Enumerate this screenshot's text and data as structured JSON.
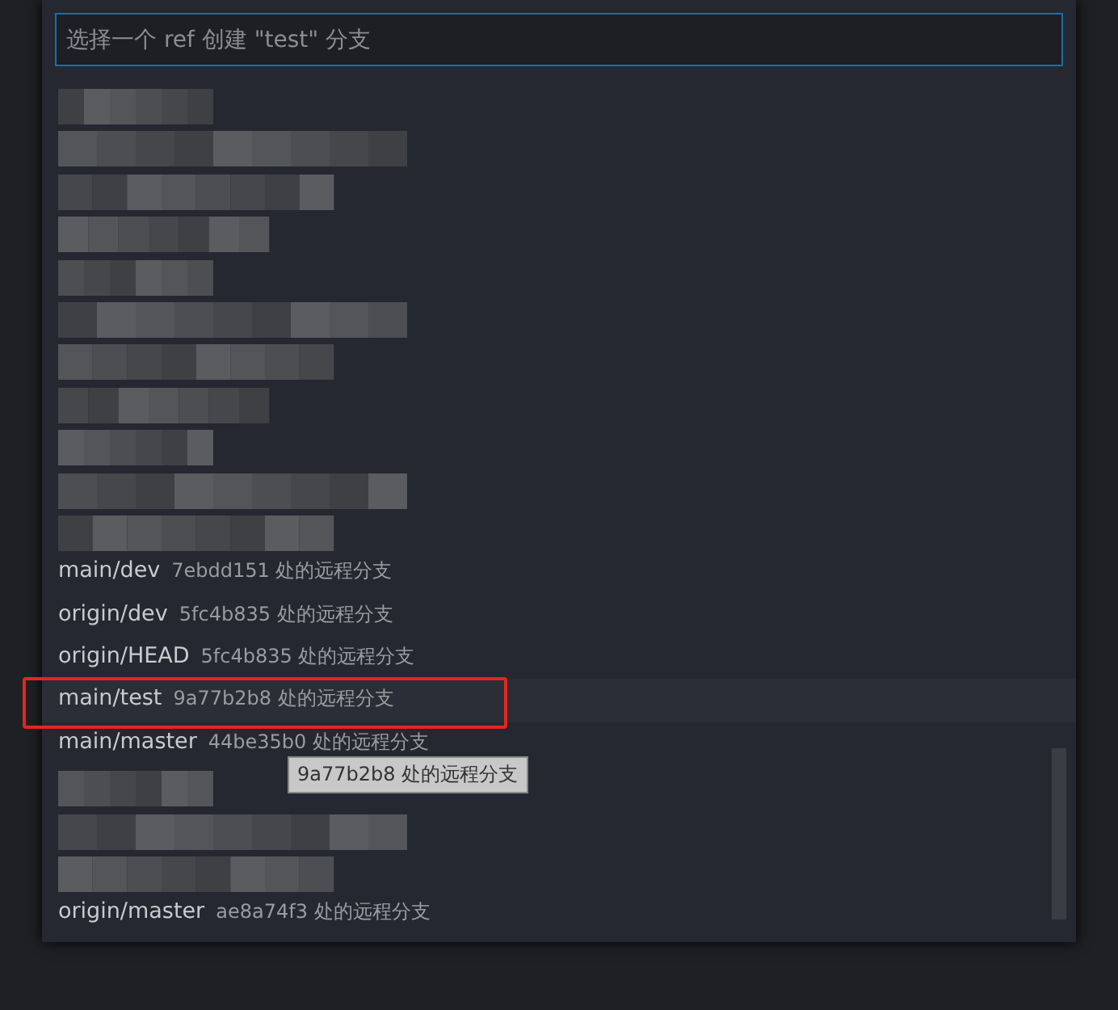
{
  "quick_pick": {
    "placeholder": "选择一个 ref 创建 \"test\" 分支",
    "items": [
      {
        "kind": "redacted"
      },
      {
        "kind": "redacted"
      },
      {
        "kind": "redacted"
      },
      {
        "kind": "redacted"
      },
      {
        "kind": "redacted"
      },
      {
        "kind": "redacted"
      },
      {
        "kind": "redacted"
      },
      {
        "kind": "redacted"
      },
      {
        "kind": "redacted"
      },
      {
        "kind": "redacted"
      },
      {
        "kind": "redacted"
      },
      {
        "kind": "branch",
        "label": "main/dev",
        "description": "7ebdd151 处的远程分支",
        "selected": false,
        "annotated": false
      },
      {
        "kind": "branch",
        "label": "origin/dev",
        "description": "5fc4b835 处的远程分支",
        "selected": false,
        "annotated": false
      },
      {
        "kind": "branch",
        "label": "origin/HEAD",
        "description": "5fc4b835 处的远程分支",
        "selected": false,
        "annotated": false
      },
      {
        "kind": "branch",
        "label": "main/test",
        "description": "9a77b2b8 处的远程分支",
        "selected": true,
        "annotated": true
      },
      {
        "kind": "branch",
        "label": "main/master",
        "description": "44be35b0 处的远程分支",
        "selected": false,
        "annotated": false
      },
      {
        "kind": "redacted"
      },
      {
        "kind": "redacted"
      },
      {
        "kind": "redacted"
      },
      {
        "kind": "branch",
        "label": "origin/master",
        "description": "ae8a74f3 处的远程分支",
        "selected": false,
        "annotated": false
      }
    ],
    "tooltip": "9a77b2b8 处的远程分支"
  }
}
